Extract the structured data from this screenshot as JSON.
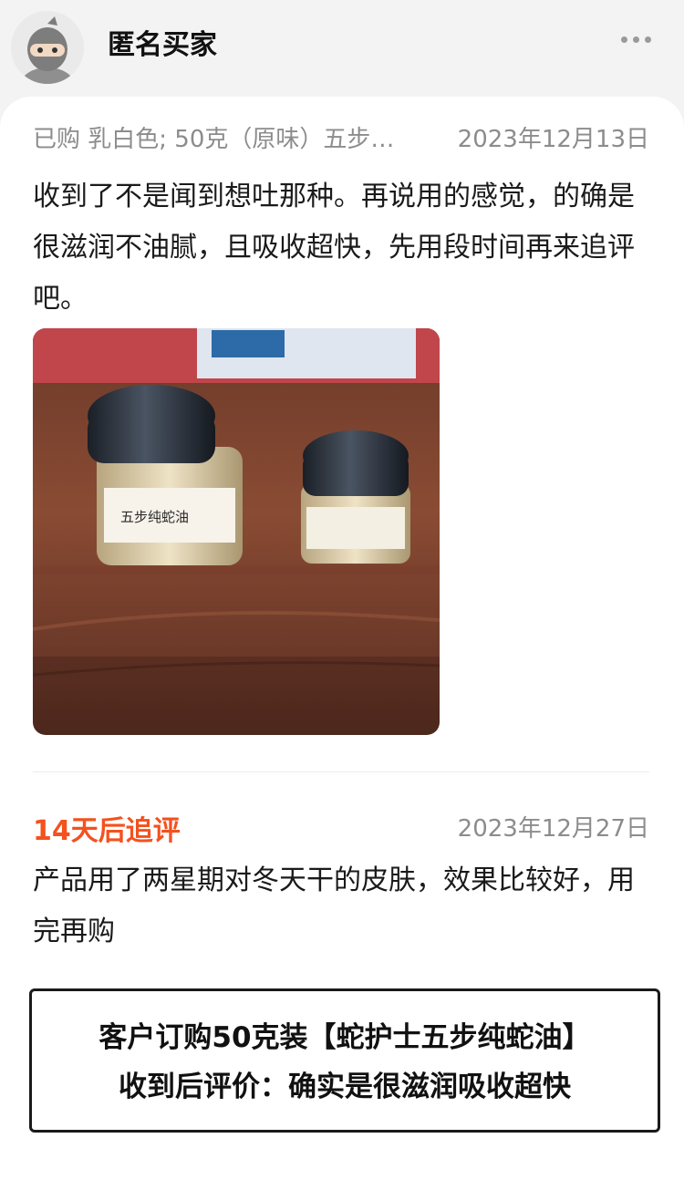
{
  "header": {
    "username": "匿名买家",
    "avatar_icon": "anonymous-ninja-avatar",
    "more_icon": "more-dots-icon"
  },
  "review": {
    "sku": "已购 乳白色; 50克（原味）五步…",
    "date": "2023年12月13日",
    "text": "收到了不是闻到想吐那种。再说用的感觉，的确是很滋润不油腻，且吸收超快，先用段时间再来追评吧。",
    "photo_label": "五步纯蛇油"
  },
  "followup": {
    "title": "14天后追评",
    "date": "2023年12月27日",
    "text": "产品用了两星期对冬天干的皮肤，效果比较好，用完再购"
  },
  "callout": {
    "line1": "客户订购50克装【蛇护士五步纯蛇油】",
    "line2": "收到后评价：确实是很滋润吸收超快"
  },
  "colors": {
    "accent": "#f4511e",
    "muted": "#8c8c8c",
    "text": "#1a1a1a"
  }
}
